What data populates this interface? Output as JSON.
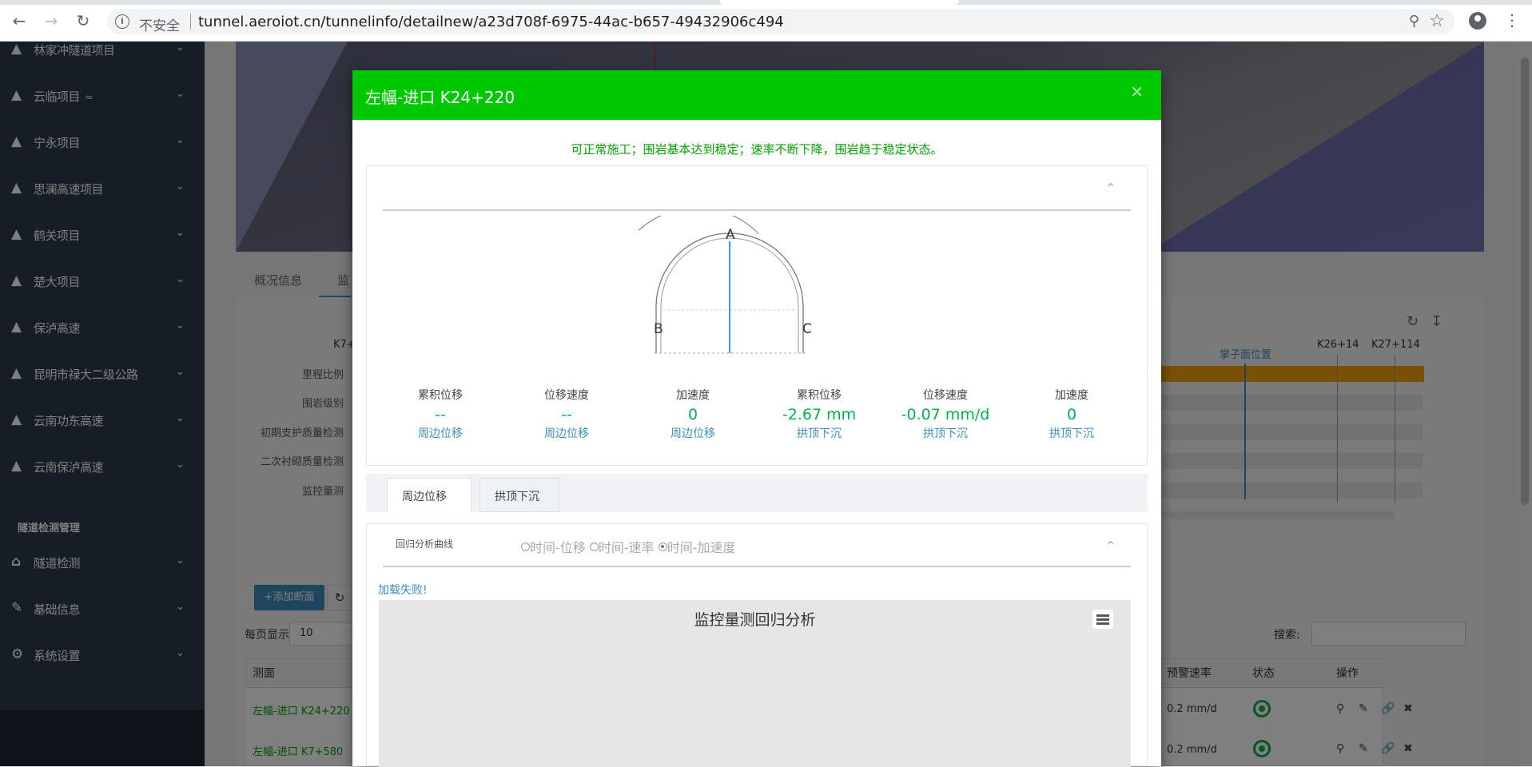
{
  "browser": {
    "insecure_label": "不安全",
    "url": "tunnel.aeroiot.cn/tunnelinfo/detailnew/a23d708f-6975-44ac-b657-49432906c494"
  },
  "sidebar": {
    "items": [
      {
        "label": "林家冲隧道项目",
        "icon": "road-icon"
      },
      {
        "label": "云临项目",
        "icon": "road-icon",
        "badge_icon": "wifi-icon"
      },
      {
        "label": "宁永项目",
        "icon": "road-icon"
      },
      {
        "label": "思澜高速项目",
        "icon": "road-icon"
      },
      {
        "label": "鹤关项目",
        "icon": "road-icon"
      },
      {
        "label": "楚大项目",
        "icon": "road-icon"
      },
      {
        "label": "保泸高速",
        "icon": "road-icon"
      },
      {
        "label": "昆明市禄大二级公路",
        "icon": "road-icon"
      },
      {
        "label": "云南功东高速",
        "icon": "road-icon"
      },
      {
        "label": "云南保泸高速",
        "icon": "road-icon"
      }
    ],
    "section_title": "隧道检测管理",
    "admin_items": [
      {
        "label": "隧道检测",
        "icon": "home-icon"
      },
      {
        "label": "基础信息",
        "icon": "edit-icon"
      },
      {
        "label": "系统设置",
        "icon": "gear-icon"
      }
    ]
  },
  "background": {
    "tabs": [
      "概况信息",
      "监"
    ],
    "row_labels": [
      "里程比例",
      "围岩级别",
      "初期支护质量检测",
      "二次衬砌质量检测",
      "监控量测"
    ],
    "left_mark": "K7+",
    "face_label": "掌子面位置",
    "mileage_marks": [
      "K26+14",
      "K27+114"
    ],
    "add_button": "+添加断面",
    "page_size_label": "每页显示",
    "page_size_value": "10",
    "search_label": "搜索:",
    "table_headers": [
      "测面",
      "预警速率",
      "状态",
      "操作"
    ],
    "rows": [
      {
        "name": "左幅-进口 K24+220",
        "rate": "0.2 mm/d"
      },
      {
        "name": "左幅-进口 K7+580",
        "rate": "0.2 mm/d"
      }
    ]
  },
  "modal": {
    "title": "左幅-进口 K24+220",
    "status_message": "可正常施工；围岩基本达到稳定；速率不断下降，围岩趋于稳定状态。",
    "diagram": {
      "point_a": "A",
      "point_b": "B",
      "point_c": "C"
    },
    "metrics": [
      {
        "name": "累积位移",
        "value": "--",
        "type": "周边位移"
      },
      {
        "name": "位移速度",
        "value": "--",
        "type": "周边位移"
      },
      {
        "name": "加速度",
        "value": "0",
        "type": "周边位移"
      },
      {
        "name": "累积位移",
        "value": "-2.67 mm",
        "type": "拱顶下沉"
      },
      {
        "name": "位移速度",
        "value": "-0.07 mm/d",
        "type": "拱顶下沉"
      },
      {
        "name": "加速度",
        "value": "0",
        "type": "拱顶下沉"
      }
    ],
    "tabs": [
      "周边位移",
      "拱顶下沉"
    ],
    "analysis_label": "回归分析曲线",
    "radio_options": [
      "时间-位移",
      "时间-速率",
      "时间-加速度"
    ],
    "radio_selected": "时间-加速度",
    "load_failed": "加载失败!",
    "chart_title": "监控量测回归分析"
  },
  "colors": {
    "modal_header": "#00c800",
    "success_text": "#00a000",
    "sidebar_bg": "#2c3b4d",
    "link_blue": "#3c8dbc"
  }
}
